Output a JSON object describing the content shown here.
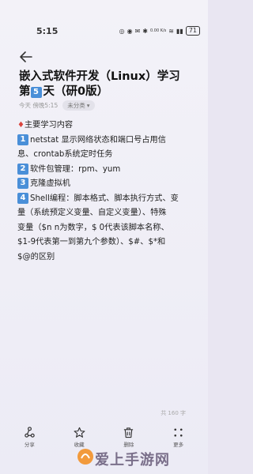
{
  "status_bar": {
    "time": "5:15",
    "network_speed": "0.00 K/s",
    "battery": "71"
  },
  "note": {
    "title_prefix": "嵌入式软件开发（Linux）学习第",
    "title_day": "5",
    "title_suffix": "天（研0版）",
    "date": "今天 傍晚5:15",
    "category": "未分类",
    "heading": "主要学习内容",
    "items": [
      {
        "num": "1",
        "text": "netstat 显示网络状态和端口号占用信",
        "cont": [
          "息、crontab系统定时任务"
        ]
      },
      {
        "num": "2",
        "text": "软件包管理：rpm、yum",
        "cont": []
      },
      {
        "num": "3",
        "text": "克隆虚拟机",
        "cont": []
      },
      {
        "num": "4",
        "text": "Shell编程：脚本格式、脚本执行方式、变",
        "cont": [
          "量（系统预定义变量、自定义变量）、特殊",
          "变量（$n  n为数字，$ 0代表该脚本名称、",
          "$1-9代表第一到第九个参数）、$#、$*和",
          "$@的区别"
        ]
      }
    ],
    "word_count": "共 160 字"
  },
  "toolbar": {
    "share": "分享",
    "favorite": "收藏",
    "delete": "删除",
    "more": "更多"
  },
  "watermark": "爱上手游网"
}
